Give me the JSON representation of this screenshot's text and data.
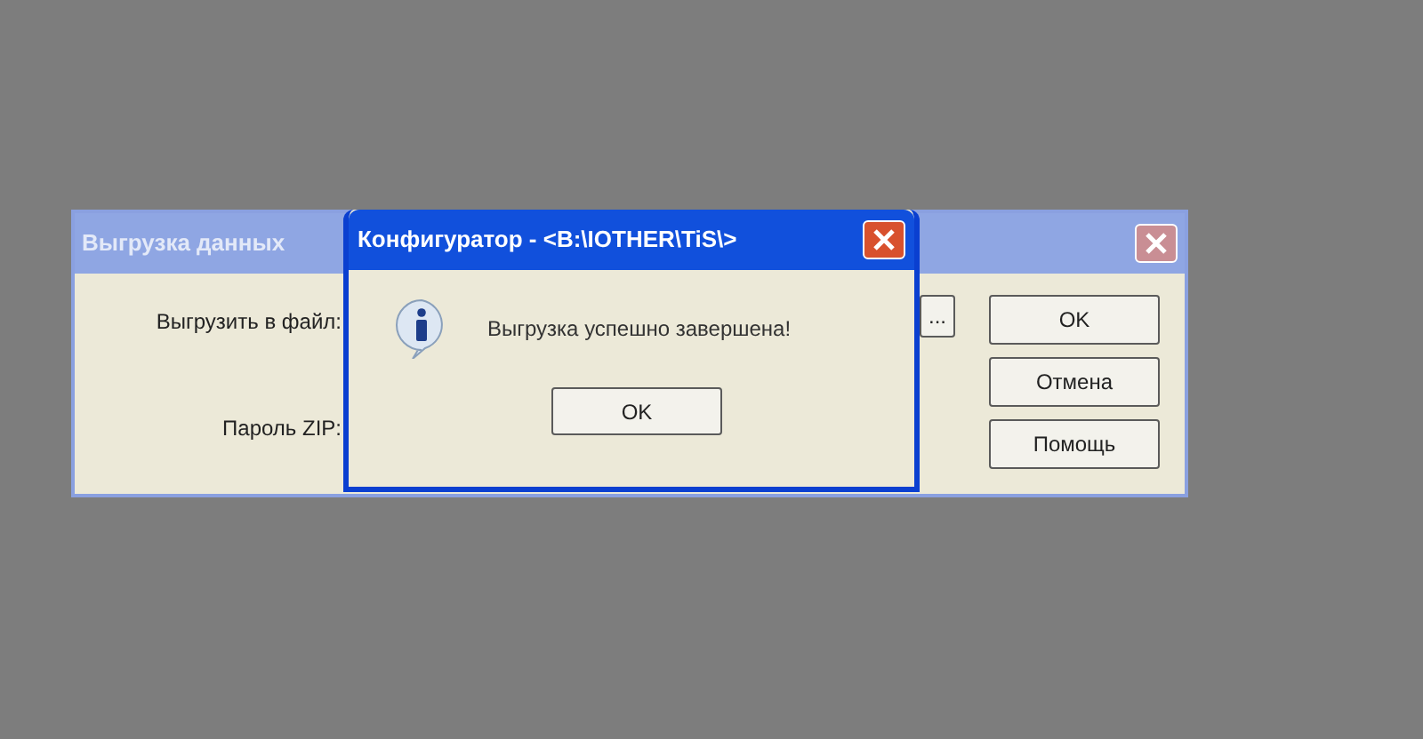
{
  "back_window": {
    "title": "Выгрузка данных",
    "fields": [
      {
        "label": "Выгрузить в файл:"
      },
      {
        "label": "Пароль ZIP:"
      }
    ],
    "browse_button": "...",
    "buttons": [
      "OK",
      "Отмена",
      "Помощь"
    ]
  },
  "message_box": {
    "title": "Конфигуратор - <B:\\IOTHER\\TiS\\>",
    "message": "Выгрузка успешно завершена!",
    "button": "OK"
  }
}
